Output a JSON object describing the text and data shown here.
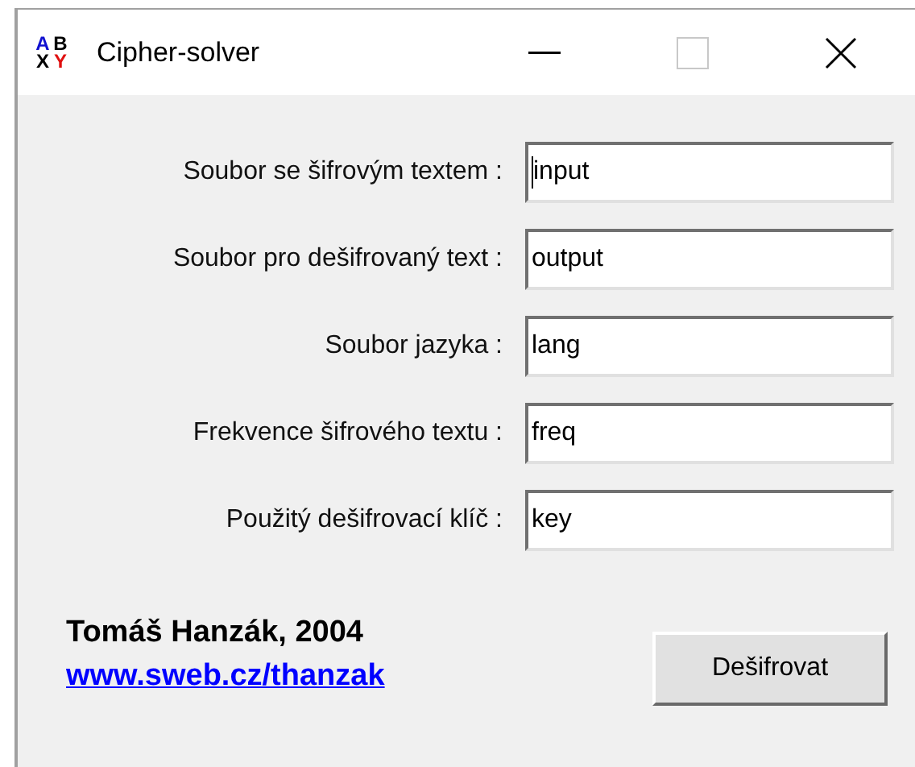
{
  "window": {
    "title": "Cipher-solver",
    "icon_letters": [
      {
        "text": "A",
        "color": "#1010d0"
      },
      {
        "text": "B",
        "color": "#000000"
      },
      {
        "text": "X",
        "color": "#000000"
      },
      {
        "text": "Y",
        "color": "#e01010"
      }
    ]
  },
  "fields": [
    {
      "label": "Soubor se šifrovým textem :",
      "value": "input",
      "focused": true
    },
    {
      "label": "Soubor pro dešifrovaný text :",
      "value": "output",
      "focused": false
    },
    {
      "label": "Soubor jazyka :",
      "value": "lang",
      "focused": false
    },
    {
      "label": "Frekvence šifrového textu :",
      "value": "freq",
      "focused": false
    },
    {
      "label": "Použitý dešifrovací klíč :",
      "value": "key",
      "focused": false
    }
  ],
  "author": "Tomáš Hanzák, 2004",
  "link": "www.sweb.cz/thanzak",
  "button": "Dešifrovat"
}
